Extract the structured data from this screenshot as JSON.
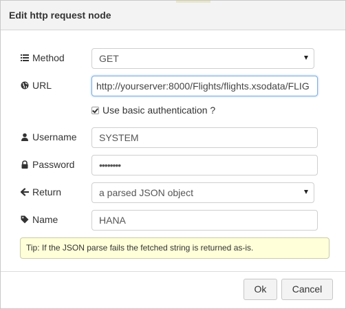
{
  "dialog": {
    "title": "Edit http request node"
  },
  "form": {
    "method": {
      "label": "Method",
      "icon": "list-icon",
      "value": "GET"
    },
    "url": {
      "label": "URL",
      "icon": "globe-icon",
      "value": "http://yourserver:8000/Flights/flights.xsodata/FLIG"
    },
    "basic_auth": {
      "label": "Use basic authentication ?",
      "checked": true
    },
    "username": {
      "label": "Username",
      "icon": "user-icon",
      "value": "SYSTEM"
    },
    "password": {
      "label": "Password",
      "icon": "lock-icon",
      "value": "••••••••"
    },
    "return": {
      "label": "Return",
      "icon": "arrow-left-icon",
      "value": "a parsed JSON object"
    },
    "name": {
      "label": "Name",
      "icon": "tag-icon",
      "value": "HANA"
    }
  },
  "tip": "Tip: If the JSON parse fails the fetched string is returned as-is.",
  "buttons": {
    "ok": "Ok",
    "cancel": "Cancel"
  }
}
